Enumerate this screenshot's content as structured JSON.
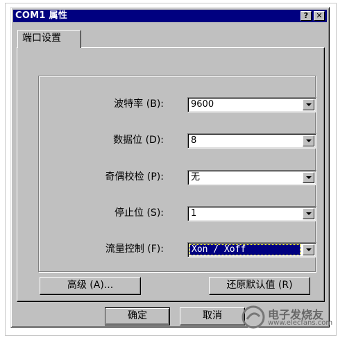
{
  "window": {
    "title": "COM1 属性",
    "help_label": "?",
    "close_label": "✕"
  },
  "tabs": [
    {
      "label": "端口设置",
      "active": true
    }
  ],
  "fields": [
    {
      "label": "波特率 (B):",
      "value": "9600"
    },
    {
      "label": "数据位 (D):",
      "value": "8"
    },
    {
      "label": "奇偶校检 (P):",
      "value": "无"
    },
    {
      "label": "停止位 (S):",
      "value": "1"
    },
    {
      "label": "流量控制 (F):",
      "value": "Xon / Xoff",
      "selected": true
    }
  ],
  "buttons": {
    "advanced": "高级 (A)...",
    "restore_defaults": "还原默认值 (R)",
    "ok": "确定",
    "cancel": "取消"
  },
  "watermark": {
    "line1": "电子发烧友",
    "line2": "www.elecfans.com"
  },
  "colors": {
    "face": "#c0c0c0",
    "titlebar": "#000080",
    "highlight": "#000080"
  }
}
